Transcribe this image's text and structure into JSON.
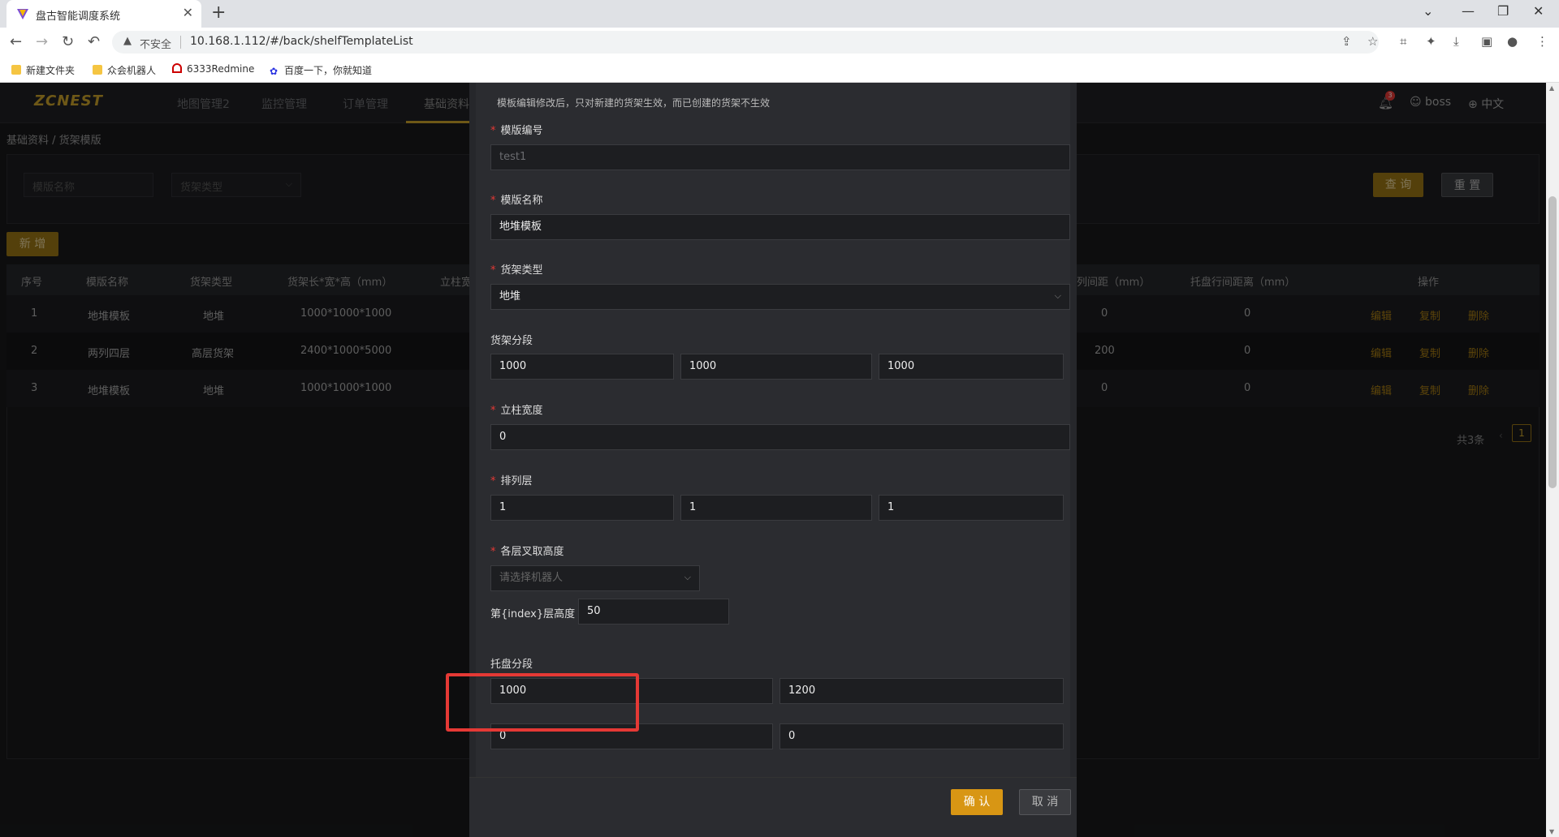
{
  "browser": {
    "tab_title": "盘古智能调度系统",
    "url": "10.168.1.112/#/back/shelfTemplateList",
    "insecure_label": "不安全",
    "bookmarks": [
      "新建文件夹",
      "众会机器人",
      "6333Redmine",
      "百度一下，你就知道"
    ]
  },
  "app": {
    "logo": "ZCNEST",
    "nav": [
      "地图管理2",
      "监控管理",
      "订单管理",
      "基础资料"
    ],
    "notifications": "3",
    "user": "boss",
    "lang": "中文",
    "breadcrumb": "基础资料  /  货架模版",
    "filters": {
      "name_placeholder": "模版名称",
      "type_placeholder": "货架类型"
    },
    "query_btn": "查 询",
    "reset_btn": "重 置",
    "add_btn": "新 增",
    "table": {
      "headers": [
        "序号",
        "模版名称",
        "货架类型",
        "货架长*宽*高（mm）",
        "立柱宽",
        "列间距（mm）",
        "托盘行间距离（mm）",
        "操作"
      ],
      "rows": [
        {
          "no": "1",
          "name": "地堆模板",
          "type": "地堆",
          "size": "1000*1000*1000",
          "col_gap": "0",
          "row_gap": "0"
        },
        {
          "no": "2",
          "name": "两列四层",
          "type": "高层货架",
          "size": "2400*1000*5000",
          "col_gap": "200",
          "row_gap": "0"
        },
        {
          "no": "3",
          "name": "地堆模板",
          "type": "地堆",
          "size": "1000*1000*1000",
          "col_gap": "0",
          "row_gap": "0"
        }
      ],
      "ops": [
        "编辑",
        "复制",
        "删除"
      ]
    },
    "pager": {
      "total": "共3条",
      "current": "1"
    }
  },
  "dialog": {
    "tip": "模板编辑修改后，只对新建的货架生效，而已创建的货架不生效",
    "template_no_label": "模版编号",
    "template_no_value": "test1",
    "template_name_label": "模版名称",
    "template_name_value": "地堆模板",
    "shelf_type_label": "货架类型",
    "shelf_type_value": "地堆",
    "shelf_segment_label": "货架分段",
    "shelf_segments": [
      "1000",
      "1000",
      "1000"
    ],
    "pillar_width_label": "立柱宽度",
    "pillar_width_value": "0",
    "row_col_layer_label": "排列层",
    "row_col_layer": [
      "1",
      "1",
      "1"
    ],
    "fork_height_label": "各层叉取高度",
    "robot_placeholder": "请选择机器人",
    "layer_height_label": "第{index}层高度",
    "layer_height_value": "50",
    "pallet_segment_label": "托盘分段",
    "pallet_segments": [
      "1000",
      "1200",
      "0",
      "0"
    ],
    "confirm_btn": "确 认",
    "cancel_btn": "取 消"
  },
  "colors": {
    "accent": "#c8a12a",
    "highlight": "#e53935"
  }
}
